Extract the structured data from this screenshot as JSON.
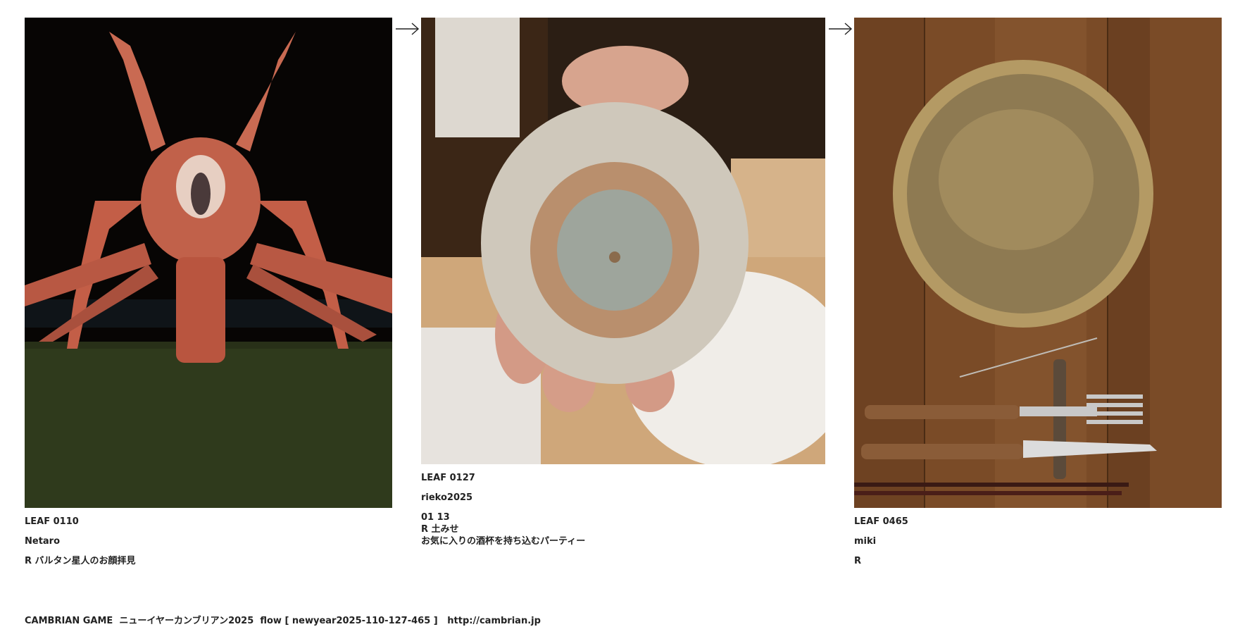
{
  "leaves": [
    {
      "id": "LEAF 0110",
      "user": "Netaro",
      "r_line": "R バルタン星人のお顔拝見",
      "photo": "giant-lobster-statue-night"
    },
    {
      "id": "LEAF 0127",
      "user": "rieko2025",
      "date": "01 13",
      "r_line": "R 土みせ",
      "description": "お気に入りの酒杯を持ち込むパーティー",
      "photo": "hand-holding-ceramic-cup-bottom"
    },
    {
      "id": "LEAF 0465",
      "user": "miki",
      "r_line": "R",
      "photo": "ceramic-plate-on-wooden-table"
    }
  ],
  "arrows": [
    "arrow-right-icon",
    "arrow-right-icon"
  ],
  "footer": {
    "brand": "CAMBRIAN GAME",
    "event": "ニューイヤーカンブリアン2025",
    "flow_label": "flow",
    "flow_value": "[ newyear2025-110-127-465 ]",
    "url": "http://cambrian.jp"
  }
}
